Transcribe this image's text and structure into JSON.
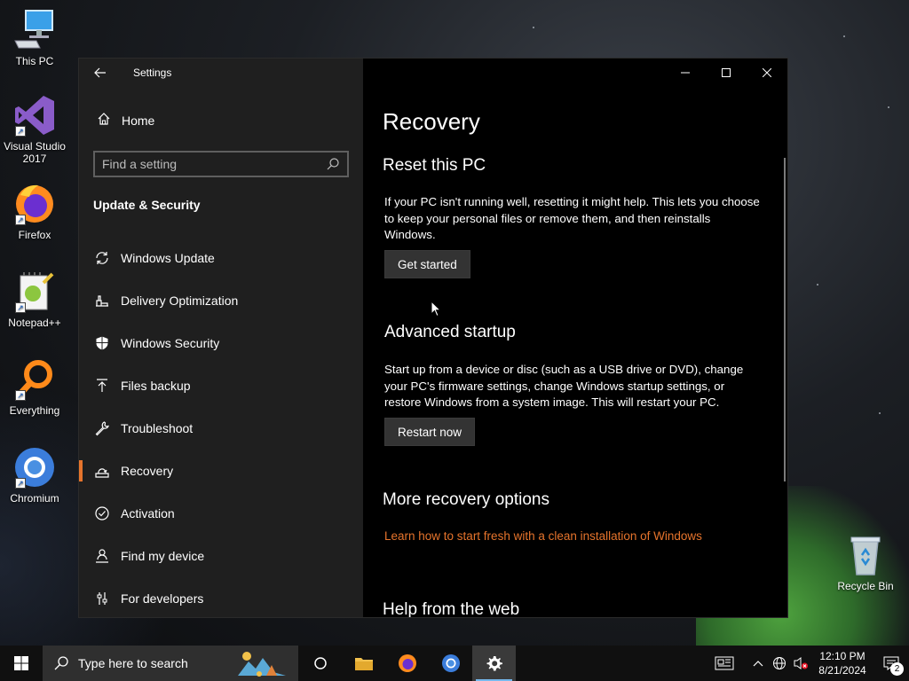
{
  "desktop": {
    "icons": [
      {
        "label": "This PC"
      },
      {
        "label": "Visual Studio 2017"
      },
      {
        "label": "Firefox"
      },
      {
        "label": "Notepad++"
      },
      {
        "label": "Everything"
      },
      {
        "label": "Chromium"
      },
      {
        "label": "Recycle Bin"
      }
    ]
  },
  "window": {
    "title": "Settings",
    "controls": {
      "minimize": "—",
      "maximize": "☐",
      "close": "✕"
    }
  },
  "sidebar": {
    "home_label": "Home",
    "search_placeholder": "Find a setting",
    "section_title": "Update & Security",
    "items": [
      {
        "label": "Windows Update",
        "icon": "refresh-icon"
      },
      {
        "label": "Delivery Optimization",
        "icon": "delivery-icon"
      },
      {
        "label": "Windows Security",
        "icon": "shield-icon"
      },
      {
        "label": "Files backup",
        "icon": "upload-arrow-icon"
      },
      {
        "label": "Troubleshoot",
        "icon": "wrench-icon"
      },
      {
        "label": "Recovery",
        "icon": "recovery-icon",
        "active": true
      },
      {
        "label": "Activation",
        "icon": "check-circle-icon"
      },
      {
        "label": "Find my device",
        "icon": "person-pin-icon"
      },
      {
        "label": "For developers",
        "icon": "developer-sliders-icon"
      }
    ]
  },
  "content": {
    "page_title": "Recovery",
    "reset": {
      "heading": "Reset this PC",
      "description": "If your PC isn't running well, resetting it might help. This lets you choose to keep your personal files or remove them, and then reinstalls Windows.",
      "button": "Get started"
    },
    "advanced": {
      "heading": "Advanced startup",
      "description": "Start up from a device or disc (such as a USB drive or DVD), change your PC's firmware settings, change Windows startup settings, or restore Windows from a system image. This will restart your PC.",
      "button": "Restart now"
    },
    "more": {
      "heading": "More recovery options",
      "link": "Learn how to start fresh with a clean installation of Windows"
    },
    "help": {
      "heading": "Help from the web"
    }
  },
  "taskbar": {
    "search_placeholder": "Type here to search",
    "clock_time": "12:10 PM",
    "clock_date": "8/21/2024",
    "notification_count": "2"
  },
  "colors": {
    "accent": "#e6742c",
    "sidebar_bg": "#1f1f1f",
    "content_bg": "#000000"
  }
}
